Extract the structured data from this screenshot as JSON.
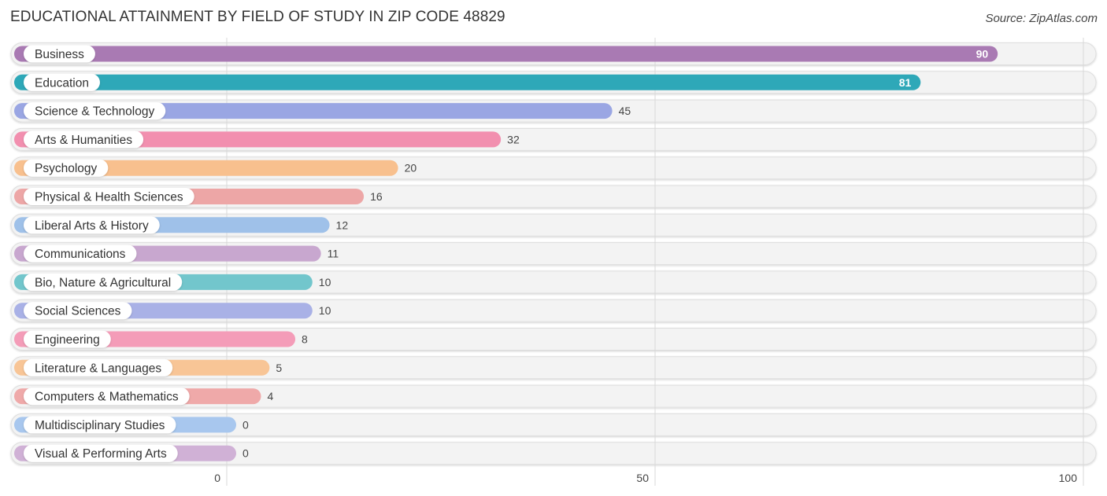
{
  "header": {
    "title": "EDUCATIONAL ATTAINMENT BY FIELD OF STUDY IN ZIP CODE 48829",
    "source": "Source: ZipAtlas.com"
  },
  "chart_data": {
    "type": "bar",
    "orientation": "horizontal",
    "title": "EDUCATIONAL ATTAINMENT BY FIELD OF STUDY IN ZIP CODE 48829",
    "xlabel": "",
    "ylabel": "",
    "xlim": [
      0,
      100
    ],
    "xticks": [
      0,
      50,
      100
    ],
    "xtick_labels": [
      "0",
      "50",
      "100"
    ],
    "grid": true,
    "categories": [
      "Business",
      "Education",
      "Science & Technology",
      "Arts & Humanities",
      "Psychology",
      "Physical & Health Sciences",
      "Liberal Arts & History",
      "Communications",
      "Bio, Nature & Agricultural",
      "Social Sciences",
      "Engineering",
      "Literature & Languages",
      "Computers & Mathematics",
      "Multidisciplinary Studies",
      "Visual & Performing Arts"
    ],
    "values": [
      90,
      81,
      45,
      32,
      20,
      16,
      12,
      11,
      10,
      10,
      8,
      5,
      4,
      0,
      0
    ],
    "value_labels": [
      "90",
      "81",
      "45",
      "32",
      "20",
      "16",
      "12",
      "11",
      "10",
      "10",
      "8",
      "5",
      "4",
      "0",
      "0"
    ],
    "colors": [
      "#a97ab3",
      "#2ea8b8",
      "#9aa6e3",
      "#f28faf",
      "#f8c08e",
      "#eda6a6",
      "#9fc1e9",
      "#c8a7cf",
      "#72c6cc",
      "#a9b1e6",
      "#f49cb8",
      "#f8c596",
      "#efa9a9",
      "#a8c7ee",
      "#d0b1d6"
    ]
  }
}
